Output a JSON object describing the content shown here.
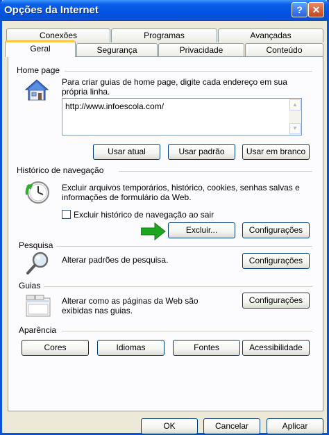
{
  "window": {
    "title": "Opções da Internet"
  },
  "tabs": {
    "row1": [
      "Conexões",
      "Programas",
      "Avançadas"
    ],
    "row2": [
      "Geral",
      "Segurança",
      "Privacidade",
      "Conteúdo"
    ],
    "active": "Geral"
  },
  "home_page": {
    "title": "Home page",
    "description_line1": "Para criar guias de home page, digite cada endereço em sua",
    "description_line2": "própria linha.",
    "url": "http://www.infoescola.com/",
    "buttons": {
      "current": "Usar atual",
      "default": "Usar padrão",
      "blank": "Usar em branco"
    }
  },
  "history": {
    "title": "Histórico de navegação",
    "description_line1": "Excluir arquivos temporários, histórico, cookies, senhas salvas e",
    "description_line2": "informações de formulário da Web.",
    "checkbox_label": "Excluir histórico de navegação ao sair",
    "checkbox_checked": false,
    "delete_button": "Excluir...",
    "settings_button": "Configurações"
  },
  "search": {
    "title": "Pesquisa",
    "description": "Alterar padrões de pesquisa.",
    "settings_button": "Configurações"
  },
  "tabs_section": {
    "title": "Guias",
    "description_line1": "Alterar como as páginas da Web são",
    "description_line2": "exibidas nas guias.",
    "settings_button": "Configurações"
  },
  "appearance": {
    "title": "Aparência",
    "buttons": {
      "colors": "Cores",
      "languages": "Idiomas",
      "fonts": "Fontes",
      "accessibility": "Acessibilidade"
    }
  },
  "footer": {
    "ok": "OK",
    "cancel": "Cancelar",
    "apply": "Aplicar"
  },
  "colors": {
    "titlebar": "#0054e3",
    "dialog_bg": "#ece9d8",
    "panel_bg": "#fcfcfe",
    "active_tab_accent": "#ffc83c",
    "arrow_green": "#1fa51f"
  }
}
